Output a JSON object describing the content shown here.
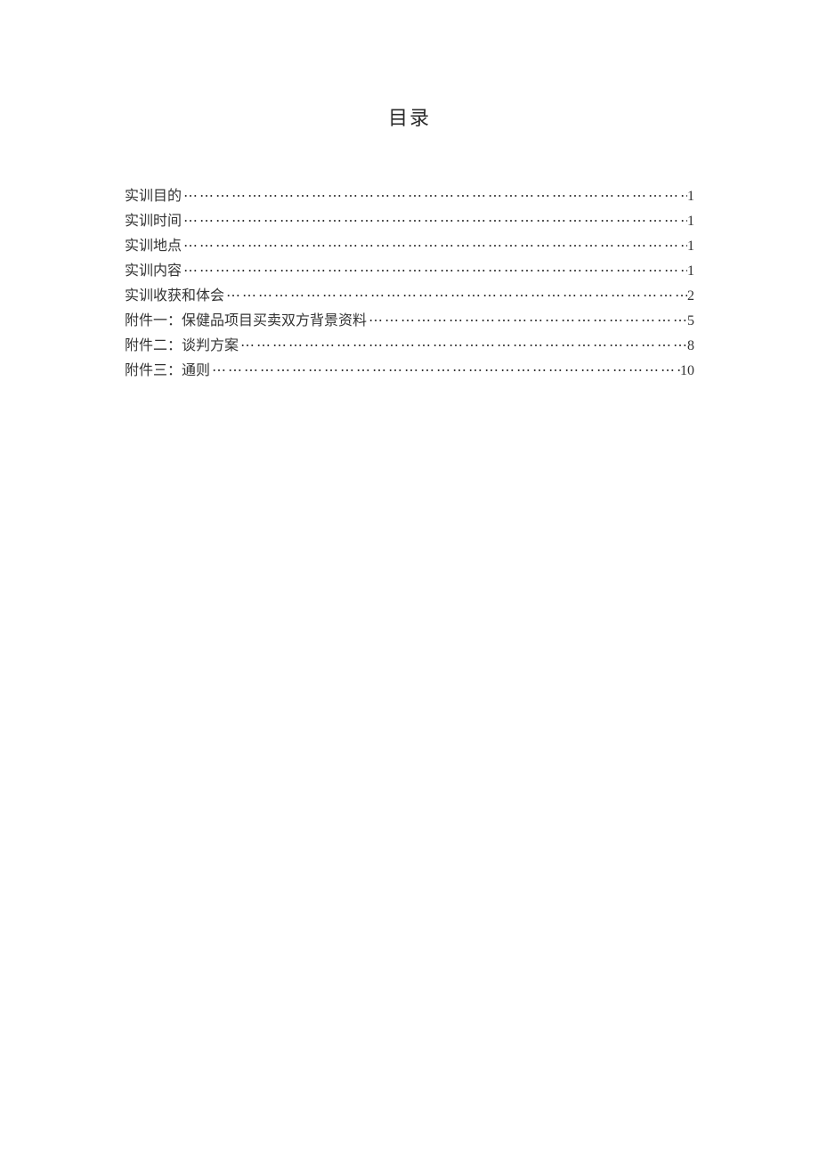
{
  "title": "目录",
  "toc": [
    {
      "label": "实训目的",
      "page": "1"
    },
    {
      "label": "实训时间",
      "page": "1"
    },
    {
      "label": "实训地点",
      "page": "1"
    },
    {
      "label": "实训内容",
      "page": "1"
    },
    {
      "label": "实训收获和体会",
      "page": "2"
    },
    {
      "label": "附件一：保健品项目买卖双方背景资料",
      "page": "5"
    },
    {
      "label": "附件二：谈判方案",
      "page": "8"
    },
    {
      "label": "附件三：通则",
      "page": "10"
    }
  ]
}
